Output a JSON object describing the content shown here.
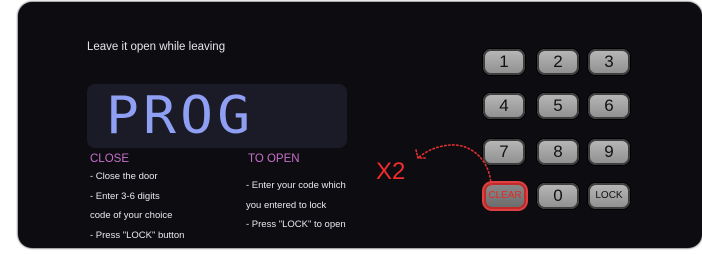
{
  "instruction": "Leave it open while leaving",
  "display": {
    "text": "PROG"
  },
  "close": {
    "title": "CLOSE",
    "steps": [
      "- Close the door",
      "- Enter 3-6 digits",
      "code of your choice",
      "- Press \"LOCK\" button"
    ]
  },
  "open": {
    "title": "TO OPEN",
    "steps": [
      "- Enter your code which",
      "you entered to lock",
      "- Press \"LOCK\" to open"
    ]
  },
  "keypad": {
    "k1": "1",
    "k2": "2",
    "k3": "3",
    "k4": "4",
    "k5": "5",
    "k6": "6",
    "k7": "7",
    "k8": "8",
    "k9": "9",
    "clear": "CLEAR",
    "k0": "0",
    "lock": "LOCK"
  },
  "annotation": {
    "label": "X2"
  },
  "colors": {
    "panel": "#0c0c11",
    "display_text": "#8f9ff3",
    "section_title": "#c66fc9",
    "clear_highlight": "#e04040"
  }
}
